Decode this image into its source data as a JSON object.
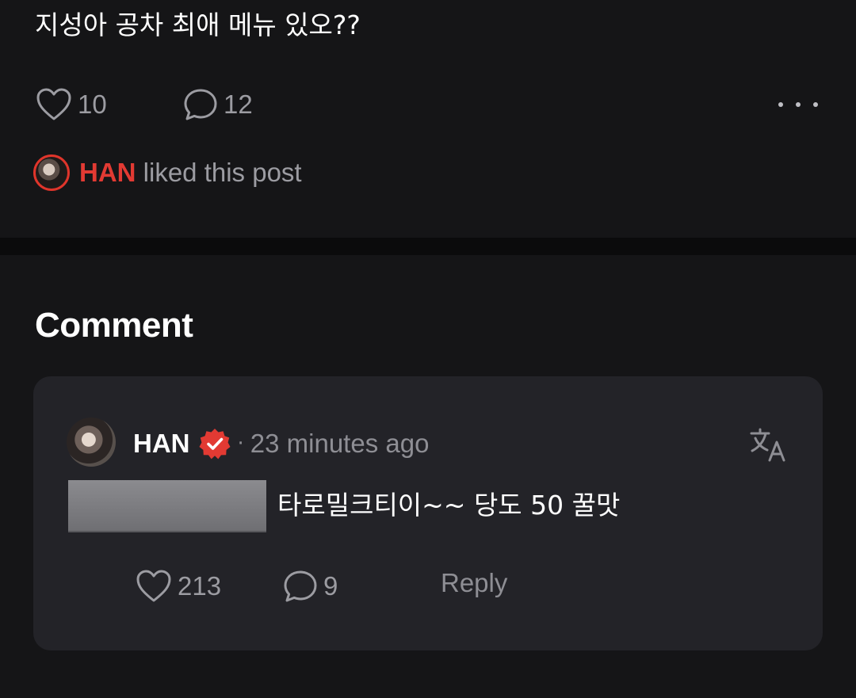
{
  "post": {
    "text": "지성아 공차 최애 메뉴 있오??",
    "likes": "10",
    "comments": "12",
    "liked_by_name": "HAN",
    "liked_by_suffix": " liked this post"
  },
  "section": {
    "title": "Comment"
  },
  "comment": {
    "author": "HAN",
    "separator": "·",
    "time": "23 minutes ago",
    "text": "타로밀크티이~~ 당도 50 꿀맛",
    "likes": "213",
    "replies": "9",
    "reply_label": "Reply"
  },
  "icons": {
    "like": "heart-icon",
    "comment": "speech-bubble-icon",
    "more": "more-horizontal-icon",
    "verified": "verified-badge-icon",
    "translate": "translate-icon"
  },
  "colors": {
    "background": "#151517",
    "card": "#232328",
    "accent_red": "#e23a33",
    "muted_text": "#9c9ca2"
  }
}
